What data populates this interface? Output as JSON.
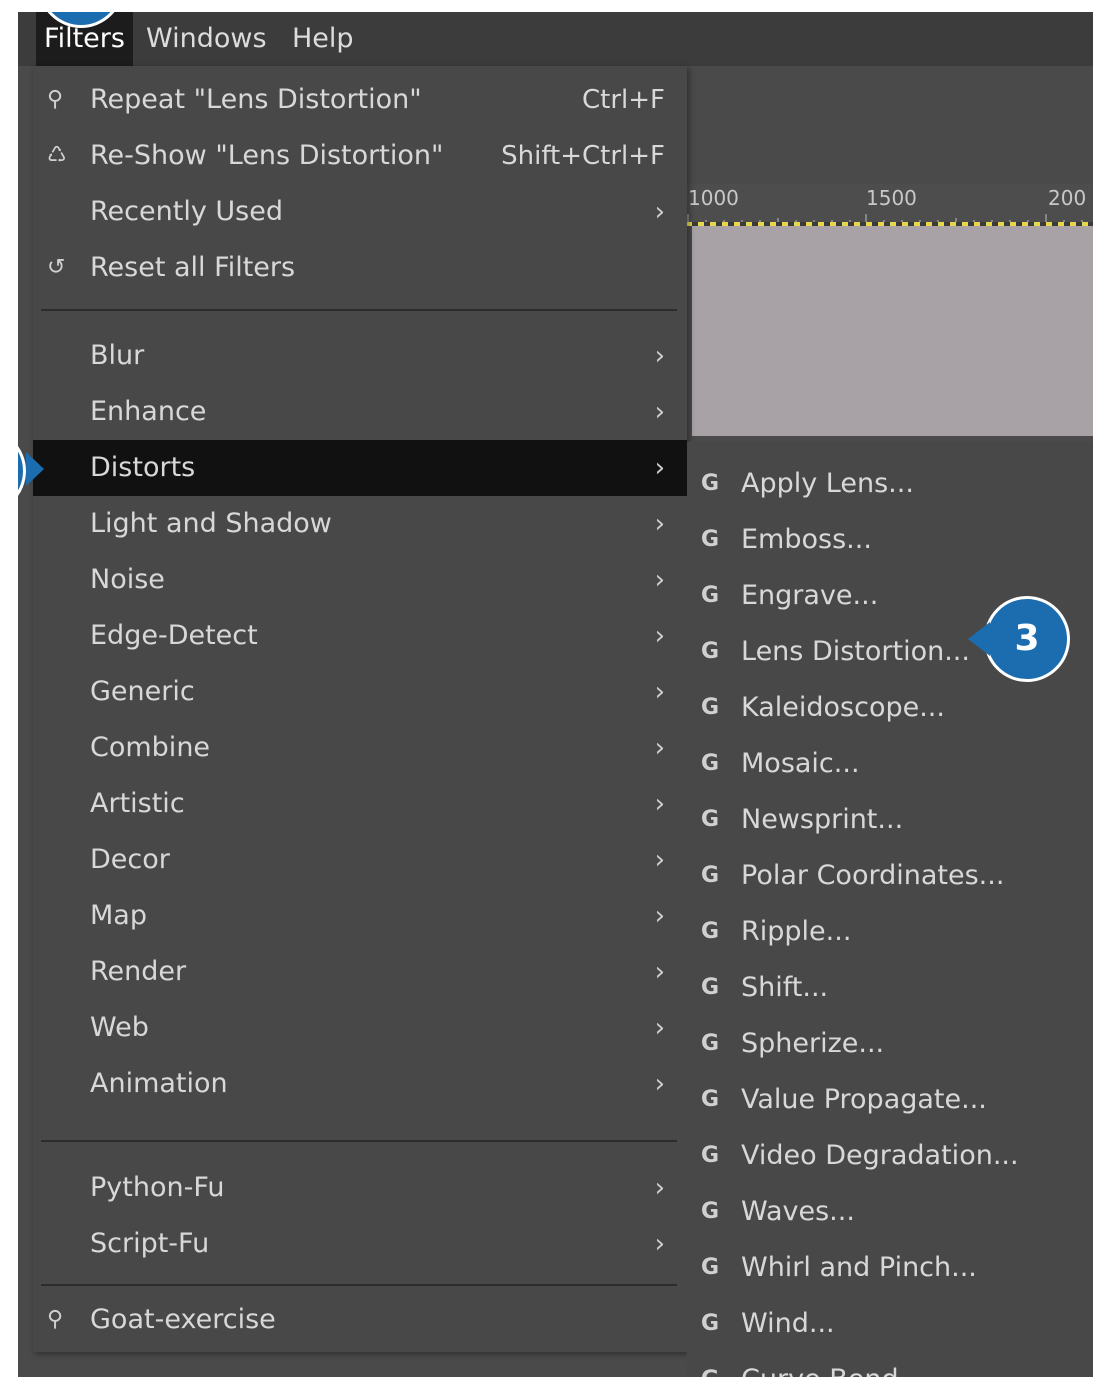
{
  "menubar": {
    "items": [
      "Filters",
      "Windows",
      "Help"
    ]
  },
  "ruler": {
    "labels": [
      "1000",
      "1500",
      "200"
    ]
  },
  "filters_menu": {
    "top_items": [
      {
        "label": "Repeat \"Lens Distortion\"",
        "shortcut": "Ctrl+F",
        "icon": "filter-icon"
      },
      {
        "label": "Re-Show \"Lens Distortion\"",
        "shortcut": "Shift+Ctrl+F",
        "icon": "reshow-icon"
      },
      {
        "label": "Recently Used",
        "arrow": "›"
      },
      {
        "label": "Reset all Filters",
        "icon": "reset-icon"
      }
    ],
    "categories": [
      "Blur",
      "Enhance",
      "Distorts",
      "Light and Shadow",
      "Noise",
      "Edge-Detect",
      "Generic",
      "Combine",
      "Artistic",
      "Decor",
      "Map",
      "Render",
      "Web",
      "Animation"
    ],
    "scripts": [
      "Python-Fu",
      "Script-Fu"
    ],
    "extra": {
      "label": "Goat-exercise",
      "icon": "filter-icon"
    },
    "arrow_glyph": "›",
    "highlighted": "Distorts"
  },
  "distorts_submenu": {
    "icon_glyph": "G",
    "items": [
      "Apply Lens...",
      "Emboss...",
      "Engrave...",
      "Lens Distortion...",
      "Kaleidoscope...",
      "Mosaic...",
      "Newsprint...",
      "Polar Coordinates...",
      "Ripple...",
      "Shift...",
      "Spherize...",
      "Value Propagate...",
      "Video Degradation...",
      "Waves...",
      "Whirl and Pinch...",
      "Wind...",
      "Curve Bend..."
    ]
  },
  "callouts": {
    "step3": "3"
  },
  "colors": {
    "menu_bg": "#484848",
    "highlight_bg": "#111111",
    "callout_blue": "#1b6db0",
    "canvas": "#a8a2a6"
  }
}
